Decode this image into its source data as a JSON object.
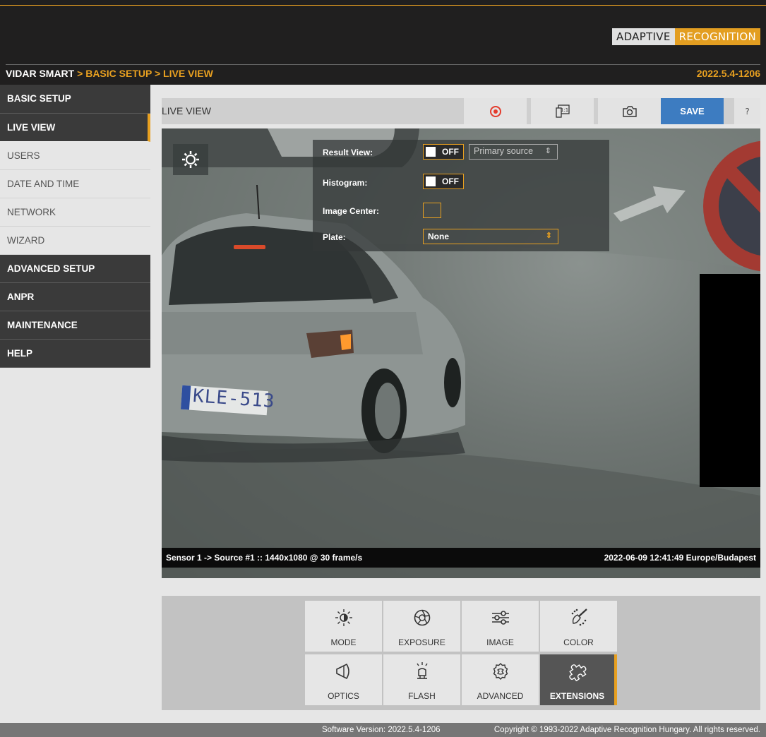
{
  "header": {
    "brand_left": "ADAPTIVE",
    "brand_right": "RECOGNITION",
    "breadcrumb": {
      "root": "VIDAR SMART",
      "sep1": " > ",
      "section": "BASIC SETUP",
      "sep2": " > ",
      "page": "LIVE VIEW"
    },
    "version": "2022.5.4-1206"
  },
  "sidebar": {
    "items": [
      {
        "label": "BASIC SETUP",
        "style": "dark"
      },
      {
        "label": "LIVE VIEW",
        "style": "active"
      },
      {
        "label": "USERS",
        "style": "light"
      },
      {
        "label": "DATE AND TIME",
        "style": "light"
      },
      {
        "label": "NETWORK",
        "style": "light"
      },
      {
        "label": "WIZARD",
        "style": "light"
      },
      {
        "label": "ADVANCED SETUP",
        "style": "dark"
      },
      {
        "label": "ANPR",
        "style": "dark"
      },
      {
        "label": "MAINTENANCE",
        "style": "dark"
      },
      {
        "label": "HELP",
        "style": "dark"
      }
    ]
  },
  "toolbar": {
    "title": "LIVE VIEW",
    "record_icon": "record-icon",
    "fit_icon": "aspect-1-1-icon",
    "snapshot_icon": "camera-icon",
    "save_label": "SAVE",
    "help_label": "?"
  },
  "overlay": {
    "result_view_label": "Result View:",
    "result_view_state": "OFF",
    "source_select": "Primary source",
    "histogram_label": "Histogram:",
    "histogram_state": "OFF",
    "image_center_label": "Image Center:",
    "plate_label": "Plate:",
    "plate_value": "None"
  },
  "camera": {
    "plate_text": "KLE-513",
    "sensor_info": "Sensor 1 -> Source #1 :: 1440x1080 @ 30 frame/s",
    "timestamp": "2022-06-09 12:41:49 Europe/Budapest"
  },
  "settings_tiles": [
    {
      "label": "MODE",
      "icon": "brightness-icon"
    },
    {
      "label": "EXPOSURE",
      "icon": "aperture-icon"
    },
    {
      "label": "IMAGE",
      "icon": "sliders-icon"
    },
    {
      "label": "COLOR",
      "icon": "palette-brush-icon"
    },
    {
      "label": "OPTICS",
      "icon": "lens-icon"
    },
    {
      "label": "FLASH",
      "icon": "flash-bulb-icon"
    },
    {
      "label": "ADVANCED",
      "icon": "settings-wrench-icon"
    },
    {
      "label": "EXTENSIONS",
      "icon": "puzzle-icon",
      "active": true
    }
  ],
  "footer": {
    "software_version": "Software Version:  2022.5.4-1206",
    "copyright": "Copyright © 1993-2022 Adaptive Recognition Hungary. All rights reserved."
  },
  "colors": {
    "accent": "#e8a020",
    "save_blue": "#3d7cc1",
    "dark_bg": "#201f1f"
  }
}
